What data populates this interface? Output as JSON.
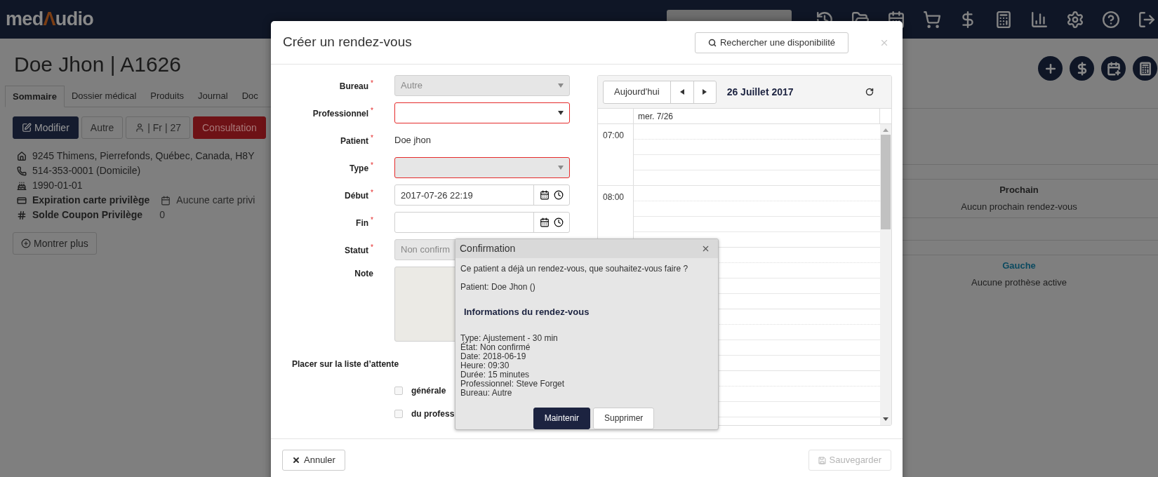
{
  "navbar": {
    "logo": [
      {
        "text": "med",
        "accent": false
      },
      {
        "text": "Λ",
        "accent": true
      },
      {
        "text": "udio",
        "accent": false
      }
    ]
  },
  "patient_page": {
    "title": "Doe Jhon | A1626",
    "tabs": [
      {
        "label": "Sommaire",
        "selected": true
      },
      {
        "label": "Dossier médical",
        "selected": false
      },
      {
        "label": "Produits",
        "selected": false
      },
      {
        "label": "Journal",
        "selected": false
      },
      {
        "label": "Doc",
        "selected": false
      }
    ],
    "action_buttons": [
      {
        "label": "Modifier",
        "kind": "primary"
      },
      {
        "label": "Autre",
        "kind": "default"
      },
      {
        "label": "| Fr | 27",
        "kind": "person"
      },
      {
        "label": "Consultation",
        "kind": "danger"
      }
    ],
    "info": [
      {
        "kind": "address",
        "text": "9245 Thimens, Pierrefonds, Québec, Canada, H8Y"
      },
      {
        "kind": "phone",
        "text": "514-353-0001 (Domicile)"
      },
      {
        "kind": "birthday",
        "text": "1990-01-01"
      },
      {
        "kind": "card",
        "label": "Expiration carte privilège",
        "value": "Aucune carte privi"
      },
      {
        "kind": "coupon",
        "label": "Solde Coupon Privilège",
        "value": "0"
      }
    ],
    "show_more": "Montrer plus"
  },
  "right_panel": {
    "sections": [
      {
        "heading": "Prochain",
        "text": "Aucun prochain rendez-vous",
        "link": false
      },
      {
        "heading": "Gauche",
        "text": "Aucune prothèse active",
        "link": true
      }
    ]
  },
  "modal": {
    "title": "Créer un rendez-vous",
    "search_button": "Rechercher une disponibilité",
    "fields": [
      {
        "label": "Bureau",
        "required_mark": "*",
        "kind": "select",
        "value": "Autre",
        "disabled": true,
        "invalid": false
      },
      {
        "label": "Professionnel",
        "required_mark": "*",
        "kind": "select",
        "disabled": false,
        "invalid": true
      },
      {
        "label": "Patient",
        "required_mark": "*",
        "kind": "static",
        "value": "Doe jhon"
      },
      {
        "label": "Type",
        "required_mark": "*",
        "kind": "select",
        "disabled": true,
        "invalid": true
      },
      {
        "label": "Début",
        "required_mark": "*",
        "kind": "datetime",
        "value": "2017-07-26 22:19"
      },
      {
        "label": "Fin",
        "required_mark": "*",
        "kind": "datetime"
      },
      {
        "label": "Statut",
        "required_mark": "*",
        "kind": "covered_select",
        "value": "Non confirm",
        "disabled": true,
        "invalid": false
      },
      {
        "label": "Note",
        "kind": "textarea"
      }
    ],
    "waitlist": {
      "label": "Placer sur la liste d’attente",
      "options": [
        {
          "label": "générale",
          "checked": false
        },
        {
          "label": "du profess",
          "checked": false
        }
      ]
    },
    "cancel_button": "Annuler",
    "save_button": {
      "label": "Sauvegarder",
      "disabled": true
    },
    "calendar": {
      "today_button": "Aujourd'hui",
      "title": "26 Juillet 2017",
      "day_header": "mer. 7/26",
      "hours": [
        "07:00",
        "08:00"
      ]
    }
  },
  "confirmation": {
    "title": "Confirmation",
    "message": "Ce patient a déjà un rendez-vous, que souhaitez-vous faire ?",
    "patient": "Patient: Doe Jhon ()",
    "heading": "Informations du rendez-vous",
    "details": [
      "Type: Ajustement - 30 min",
      "État: Non confirmé",
      "Date: 2018-06-19",
      "Heure: 09:30",
      "Durée: 15 minutes",
      "Professionnel: Steve Forget",
      "Bureau: Autre"
    ],
    "buttons": [
      {
        "label": "Maintenir",
        "kind": "primary"
      },
      {
        "label": "Supprimer",
        "kind": "default"
      }
    ]
  }
}
